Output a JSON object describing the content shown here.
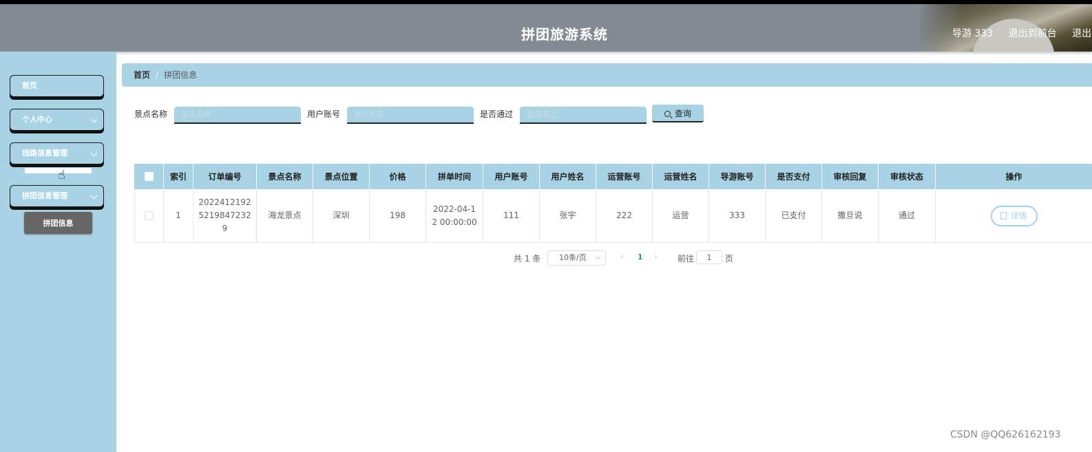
{
  "header": {
    "title": "拼团旅游系统",
    "user": "导游 333",
    "exit_front": "退出到前台",
    "logout": "退出"
  },
  "sidebar": {
    "items": [
      {
        "label": "首页"
      },
      {
        "label": "个人中心"
      },
      {
        "label": "线路信息管理"
      },
      {
        "label": "拼团信息管理"
      }
    ],
    "sub_item": "拼团信息"
  },
  "breadcrumb": {
    "home": "首页",
    "separator": "/",
    "current": "拼团信息"
  },
  "search": {
    "field1_label": "景点名称",
    "field1_placeholder": "景点名称",
    "field2_label": "用户账号",
    "field2_placeholder": "用户账号",
    "field3_label": "是否通过",
    "field3_placeholder": "是否通过",
    "button_label": "查询"
  },
  "table": {
    "columns": [
      "索引",
      "订单编号",
      "景点名称",
      "景点位置",
      "价格",
      "拼单时间",
      "用户账号",
      "用户姓名",
      "运营账号",
      "运营姓名",
      "导游账号",
      "是否支付",
      "审核回复",
      "审核状态",
      "操作"
    ],
    "rows": [
      {
        "index": "1",
        "order_no": "20224121925219847232 9",
        "order_no_lines": [
          "2022412192",
          "5219847232",
          "9"
        ],
        "spot_name": "海龙景点",
        "spot_location": "深圳",
        "price": "198",
        "time_lines": [
          "2022-04-1",
          "2 00:00:00"
        ],
        "user_account": "111",
        "user_name": "张宇",
        "op_account": "222",
        "op_name": "运营",
        "guide_account": "333",
        "paid": "已支付",
        "review_reply": "撒旦说",
        "review_status": "通过",
        "action": "详情"
      }
    ]
  },
  "pagination": {
    "total": "共 1 条",
    "page_size": "10条/页",
    "prev": "‹",
    "current": "1",
    "next": "›",
    "goto": "前往",
    "page_input": "1",
    "page_unit": "页"
  },
  "watermark": "CSDN @QQ626162193"
}
